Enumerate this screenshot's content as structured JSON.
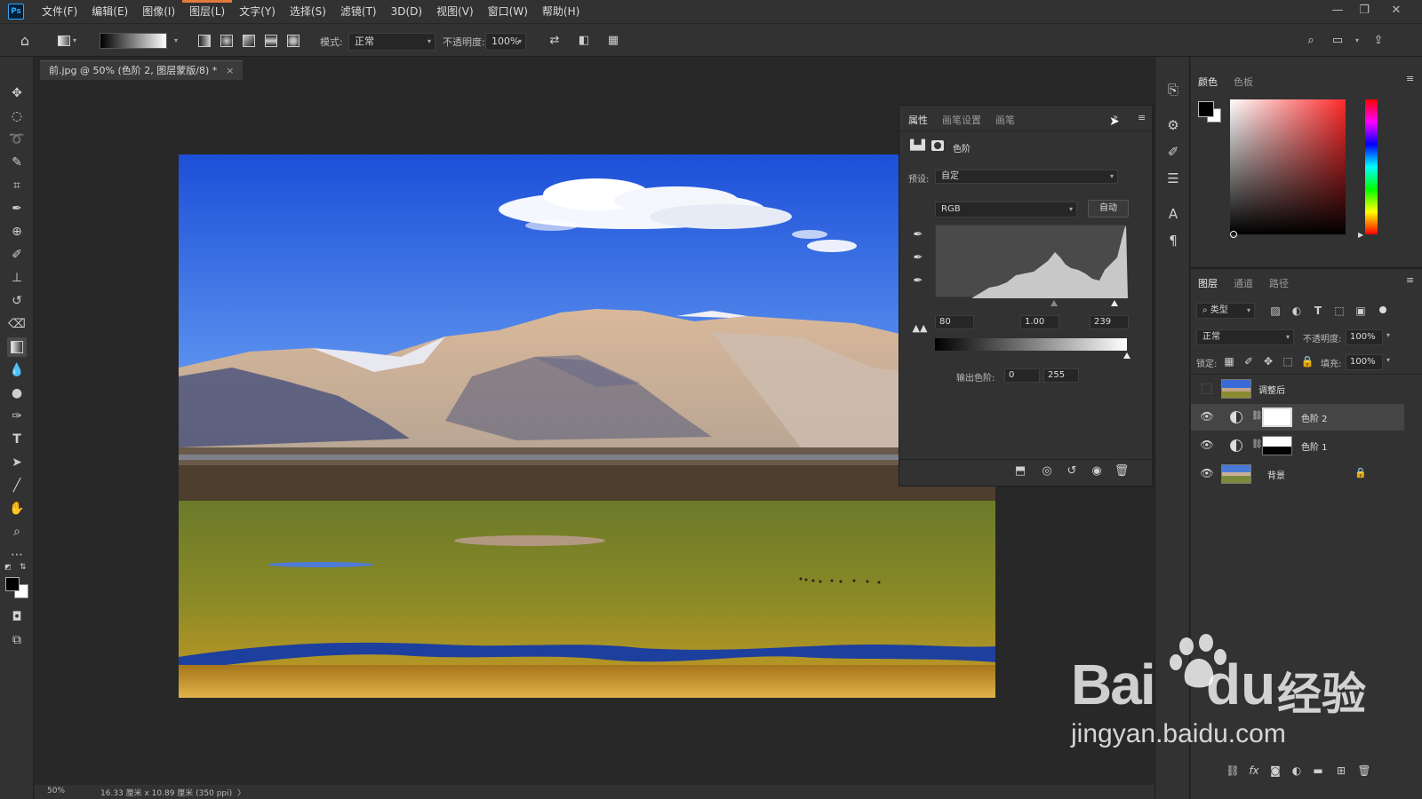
{
  "menubar": {
    "logo": "Ps",
    "items": [
      "文件(F)",
      "编辑(E)",
      "图像(I)",
      "图层(L)",
      "文字(Y)",
      "选择(S)",
      "滤镜(T)",
      "3D(D)",
      "视图(V)",
      "窗口(W)",
      "帮助(H)"
    ],
    "active_index": 3
  },
  "options": {
    "mode_label": "模式:",
    "mode_value": "正常",
    "opacity_label": "不透明度:",
    "opacity_value": "100%"
  },
  "document": {
    "tab_title": "前.jpg @ 50% (色阶 2, 图层蒙版/8) *",
    "tab_close": "×",
    "zoom": "50%",
    "doc_size": "16.33 厘米 x 10.89 厘米 (350 ppi)",
    "status_arrow": "〉"
  },
  "properties": {
    "tabs": [
      "属性",
      "画笔设置",
      "画笔"
    ],
    "active_tab": 0,
    "adjust_name": "色阶",
    "preset_label": "预设:",
    "preset_value": "自定",
    "channel_value": "RGB",
    "auto_button": "自动",
    "input_black": "80",
    "input_gamma": "1.00",
    "input_white": "239",
    "output_label": "输出色阶:",
    "output_black": "0",
    "output_white": "255"
  },
  "color_panel": {
    "tabs": [
      "颜色",
      "色板"
    ],
    "active_tab": 0,
    "hue_color": "#ff2a2a"
  },
  "layers_panel": {
    "tabs": [
      "图层",
      "通道",
      "路径"
    ],
    "active_tab": 0,
    "filter_value": "类型",
    "blend_mode": "正常",
    "opacity_label": "不透明度:",
    "opacity_value": "100%",
    "lock_label": "锁定:",
    "fill_label": "填充:",
    "fill_value": "100%",
    "layers": [
      {
        "name": "调整后",
        "visible": false,
        "selected": false
      },
      {
        "name": "色阶 2",
        "visible": true,
        "selected": true
      },
      {
        "name": "色阶 1",
        "visible": true,
        "selected": false
      },
      {
        "name": "背景",
        "visible": true,
        "selected": false
      }
    ]
  },
  "watermark": {
    "brand": "Bai",
    "brand2": "du",
    "cn": "经验",
    "url": "jingyan.baidu.com"
  },
  "colors": {
    "accent": "#31a8ff",
    "menu_active": "#e07a3a",
    "sky": "#2a5fe0",
    "panel": "#323232"
  }
}
